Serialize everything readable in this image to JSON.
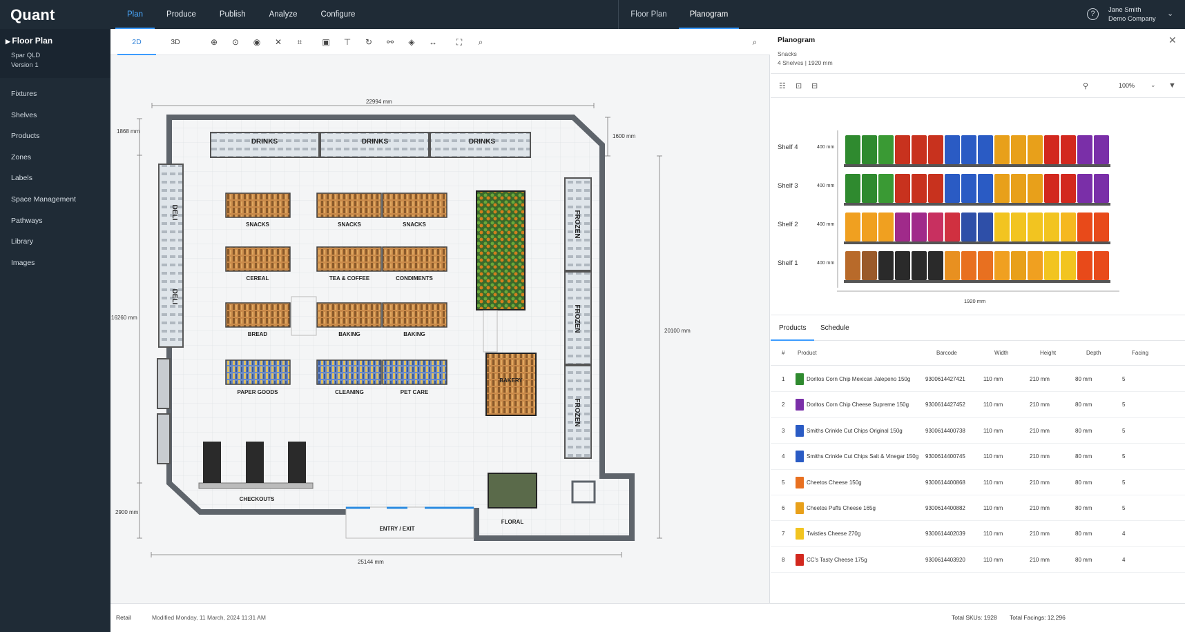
{
  "app": {
    "logo": "Quant"
  },
  "topnav": {
    "tabs": [
      "Plan",
      "Produce",
      "Publish",
      "Analyze",
      "Configure"
    ],
    "active": "Plan"
  },
  "viewtabs": {
    "tabs": [
      "Floor Plan",
      "Planogram"
    ],
    "active": "Planogram"
  },
  "user": {
    "name": "Jane Smith",
    "company": "Demo Company"
  },
  "sidebar": {
    "title": "Floor Plan",
    "store": "Spar QLD",
    "version": "Version 1",
    "items": [
      "Fixtures",
      "Shelves",
      "Products",
      "Zones",
      "Labels",
      "Space Management",
      "Pathways",
      "Library",
      "Images"
    ]
  },
  "toolbar": {
    "mode_2d": "2D",
    "mode_3d": "3D"
  },
  "floorplan": {
    "dims": {
      "top": "22994 mm",
      "bottom": "25144 mm",
      "left_top": "1868 mm",
      "left_mid": "16260 mm",
      "left_bottom": "2900 mm",
      "right_top": "1600 mm",
      "right_mid": "20100 mm"
    },
    "labels": {
      "drinks1": "DRINKS",
      "drinks2": "DRINKS",
      "drinks3": "DRINKS",
      "deli1": "DELI",
      "deli2": "DELI",
      "frozen1": "FROZEN",
      "frozen2": "FROZEN",
      "frozen3": "FROZEN",
      "snacks1": "SNACKS",
      "snacks2": "SNACKS",
      "snacks3": "SNACKS",
      "cereal": "CEREAL",
      "tea": "TEA & COFFEE",
      "condiments": "CONDIMENTS",
      "bread": "BREAD",
      "baking1": "BAKING",
      "baking2": "BAKING",
      "paper": "PAPER GOODS",
      "cleaning": "CLEANING",
      "petcare": "PET CARE",
      "bakery": "BAKERY",
      "checkouts": "CHECKOUTS",
      "entry": "ENTRY / EXIT",
      "floral": "FLORAL"
    }
  },
  "panel": {
    "title": "Planogram",
    "category": "Snacks",
    "summary": "4 Shelves | 1920 mm",
    "zoom": "100%",
    "shelves": [
      {
        "label": "Shelf 4",
        "height": "400 mm",
        "colors": [
          "#2f8a2f",
          "#2f8a2f",
          "#3a9a34",
          "#c8321e",
          "#c8321e",
          "#c8321e",
          "#2a5bc4",
          "#2a5bc4",
          "#2a5bc4",
          "#e8a01a",
          "#e8a01a",
          "#e8a01a",
          "#d2281e",
          "#d2281e",
          "#7a2fa8",
          "#7a2fa8"
        ]
      },
      {
        "label": "Shelf 3",
        "height": "400 mm",
        "colors": [
          "#2f8a2f",
          "#2f8a2f",
          "#3a9a34",
          "#c8321e",
          "#c8321e",
          "#c8321e",
          "#2a5bc4",
          "#2a5bc4",
          "#2a5bc4",
          "#e8a01a",
          "#e8a01a",
          "#e8a01a",
          "#d2281e",
          "#d2281e",
          "#7a2fa8",
          "#7a2fa8"
        ]
      },
      {
        "label": "Shelf 2",
        "height": "400 mm",
        "colors": [
          "#f0a020",
          "#f0a020",
          "#f0a020",
          "#a02a8a",
          "#a02a8a",
          "#c83060",
          "#d03040",
          "#2e4fa8",
          "#2e4fa8",
          "#f2c420",
          "#f2c420",
          "#f2c420",
          "#f2c420",
          "#f5b820",
          "#e84a1a",
          "#e84a1a"
        ]
      },
      {
        "label": "Shelf 1",
        "height": "400 mm",
        "colors": [
          "#b86a2a",
          "#9a5a2a",
          "#2a2a2a",
          "#2a2a2a",
          "#2a2a2a",
          "#2a2a2a",
          "#e89020",
          "#e87020",
          "#e87020",
          "#f0a020",
          "#e8a01a",
          "#f0a020",
          "#f2c420",
          "#f2c420",
          "#e84a1a",
          "#e84a1a"
        ]
      }
    ],
    "width_label": "1920 mm",
    "tabs": [
      "Products",
      "Schedule"
    ],
    "active_tab": "Products",
    "columns": [
      "#",
      "Product",
      "Barcode",
      "Width",
      "Height",
      "Depth",
      "Facing"
    ],
    "rows": [
      {
        "n": "1",
        "product": "Doritos Corn Chip Mexican Jalepeno 150g",
        "barcode": "9300614427421",
        "width": "110 mm",
        "height": "210 mm",
        "depth": "80 mm",
        "facing": "5",
        "color": "#2f8a2f"
      },
      {
        "n": "2",
        "product": "Doritos Corn Chip Cheese Supreme 150g",
        "barcode": "9300614427452",
        "width": "110 mm",
        "height": "210 mm",
        "depth": "80 mm",
        "facing": "5",
        "color": "#7a2fa8"
      },
      {
        "n": "3",
        "product": "Smiths Crinkle Cut Chips Original 150g",
        "barcode": "9300614400738",
        "width": "110 mm",
        "height": "210 mm",
        "depth": "80 mm",
        "facing": "5",
        "color": "#2a5bc4"
      },
      {
        "n": "4",
        "product": "Smiths Crinkle Cut Chips Salt & Vinegar 150g",
        "barcode": "9300614400745",
        "width": "110 mm",
        "height": "210 mm",
        "depth": "80 mm",
        "facing": "5",
        "color": "#2a5bc4"
      },
      {
        "n": "5",
        "product": "Cheetos Cheese 150g",
        "barcode": "9300614400868",
        "width": "110 mm",
        "height": "210 mm",
        "depth": "80 mm",
        "facing": "5",
        "color": "#e87020"
      },
      {
        "n": "6",
        "product": "Cheetos Puffs Cheese 165g",
        "barcode": "9300614400882",
        "width": "110 mm",
        "height": "210 mm",
        "depth": "80 mm",
        "facing": "5",
        "color": "#e8a01a"
      },
      {
        "n": "7",
        "product": "Twisties Cheese 270g",
        "barcode": "9300614402039",
        "width": "110 mm",
        "height": "210 mm",
        "depth": "80 mm",
        "facing": "4",
        "color": "#f2c420"
      },
      {
        "n": "8",
        "product": "CC's Tasty Cheese 175g",
        "barcode": "9300614403920",
        "width": "110 mm",
        "height": "210 mm",
        "depth": "80 mm",
        "facing": "4",
        "color": "#d2281e"
      }
    ]
  },
  "footer": {
    "retail": "Retail",
    "modified": "Modified Monday, 11 March, 2024 11:31 AM",
    "skus": "Total SKUs: 1928",
    "facings": "Total Facings: 12,296"
  }
}
